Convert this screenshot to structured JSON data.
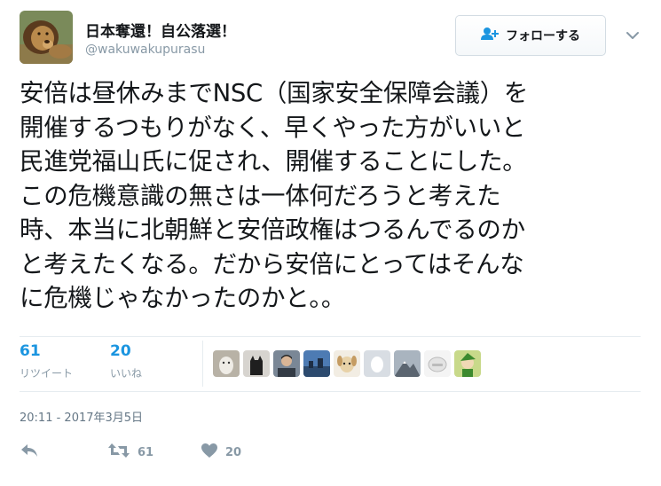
{
  "user": {
    "display_name": "日本奪還！自公落選！",
    "handle": "@wakuwakupurasu",
    "avatar_icon": "lion-avatar"
  },
  "follow_button": {
    "label": "フォローする",
    "icon": "add-user-icon"
  },
  "tweet": {
    "lines": [
      "安倍は昼休みまでNSC（国家安全保障会議）を",
      "開催するつもりがなく、早くやった方がいいと",
      "民進党福山氏に促され、開催することにした。",
      "この危機意識の無さは一体何だろうと考えた",
      "時、本当に北朝鮮と安倍政権はつるんでるのか",
      "と考えたくなる。だから安倍にとってはそんな",
      "に危機じゃなかったのかと。。"
    ]
  },
  "stats": {
    "retweets": {
      "count": "61",
      "label": "リツイート"
    },
    "likes": {
      "count": "20",
      "label": "いいね"
    }
  },
  "likers": [
    "dog-avatar",
    "black-cat-avatar",
    "person-avatar",
    "cityscape-avatar",
    "cartoon-dog-avatar",
    "egg-avatar",
    "mountain-avatar",
    "toy-avatar",
    "green-character-avatar"
  ],
  "timestamp": "20:11 - 2017年3月5日",
  "actions": {
    "retweet_count": "61",
    "like_count": "20"
  },
  "colors": {
    "link_blue": "#1b95e0",
    "muted_gray": "#8899a6",
    "text": "#14171a",
    "divider": "#e6ecf0"
  }
}
